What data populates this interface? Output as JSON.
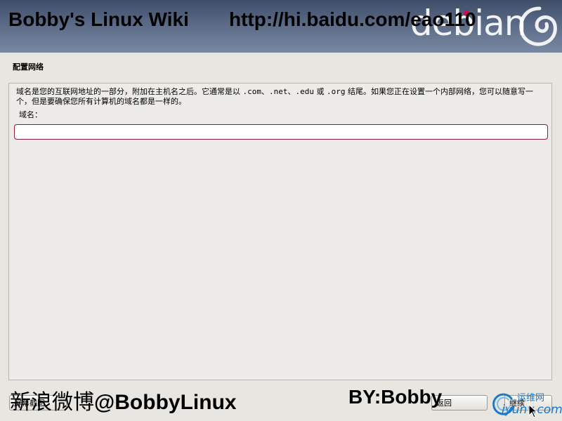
{
  "header": {
    "brand_word": "debian",
    "watermark_title": "Bobby's Linux Wiki",
    "watermark_url": "http://hi.baidu.com/eao110"
  },
  "step": {
    "title": "配置网络"
  },
  "form": {
    "description_part1": "域名是您的互联网地址的一部分，附加在主机名之后。它通常是以 ",
    "ext_com": ".com",
    "sep1": "、",
    "ext_net": ".net",
    "sep2": "、",
    "ext_edu": ".edu",
    "or_word": " 或 ",
    "ext_org": ".org",
    "description_part2": " 结尾。如果您正在设置一个内部网络，您可以随意写一个，但是要确保您所有计算机的域名都是一样的。",
    "field_label": "域名：",
    "field_value": ""
  },
  "buttons": {
    "screenshot_label": "屏幕截图",
    "back_label": "返回",
    "continue_label": "继续"
  },
  "watermarks": {
    "weibo_cn": "新浪微博",
    "weibo_handle": "@BobbyLinux",
    "by": "BY:Bobby",
    "site_cn": "运维网",
    "site_en": "iyunv.com"
  },
  "colors": {
    "accent": "#d70751",
    "input_border": "#8c1d3c",
    "link_blue": "#1e78c8"
  },
  "icons": {
    "logo": "debian-swirl-icon",
    "cursor": "mouse-pointer-icon",
    "site_logo": "iyunv-ring-icon"
  }
}
